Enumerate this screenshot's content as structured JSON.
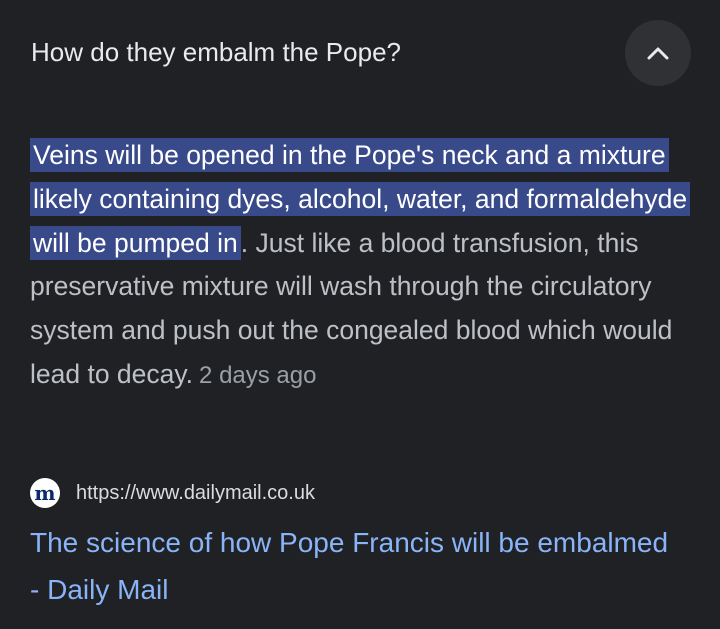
{
  "question": "How do they embalm the Pope?",
  "collapse_button": {
    "icon": "chevron-up-icon"
  },
  "answer": {
    "highlighted": "Veins will be opened in the Pope's neck and a mixture likely containing dyes, alcohol, water, and formaldehyde will be pumped in",
    "rest": ". Just like a blood transfusion, this preservative mixture will wash through the circulatory system and push out the congealed blood which would lead to decay.",
    "date": "2 days ago"
  },
  "source": {
    "favicon_letter": "m",
    "url": "https://www.dailymail.co.uk",
    "title": "The science of how Pope Francis will be embalmed - Daily Mail"
  },
  "colors": {
    "background": "#202124",
    "highlight": "#394a8a",
    "link": "#8ab4f8"
  }
}
